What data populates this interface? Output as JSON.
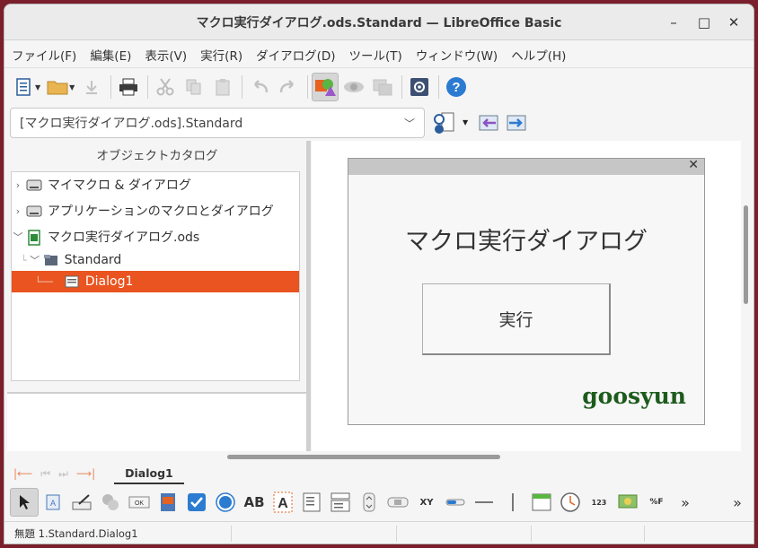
{
  "window": {
    "title": "マクロ実行ダイアログ.ods.Standard — LibreOffice Basic"
  },
  "menu": [
    "ファイル(F)",
    "編集(E)",
    "表示(V)",
    "実行(R)",
    "ダイアログ(D)",
    "ツール(T)",
    "ウィンドウ(W)",
    "ヘルプ(H)"
  ],
  "library_selector": {
    "value": "[マクロ実行ダイアログ.ods].Standard"
  },
  "object_catalog": {
    "title": "オブジェクトカタログ",
    "items": [
      {
        "label": "マイマクロ & ダイアログ"
      },
      {
        "label": "アプリケーションのマクロとダイアログ"
      },
      {
        "label": "マクロ実行ダイアログ.ods"
      },
      {
        "label": "Standard"
      },
      {
        "label": "Dialog1"
      }
    ]
  },
  "dialog_preview": {
    "label": "マクロ実行ダイアログ",
    "button": "実行",
    "brand": "goosyun"
  },
  "tabs": [
    {
      "label": "Dialog1"
    }
  ],
  "controls": {
    "textfield_label": "AB",
    "numeric_label": "123",
    "formatted_label": "%F",
    "xy_label": "XY"
  },
  "status": {
    "text": "無題 1.Standard.Dialog1"
  },
  "colors": {
    "accent": "#e95420",
    "brand": "#1d5b1d"
  }
}
